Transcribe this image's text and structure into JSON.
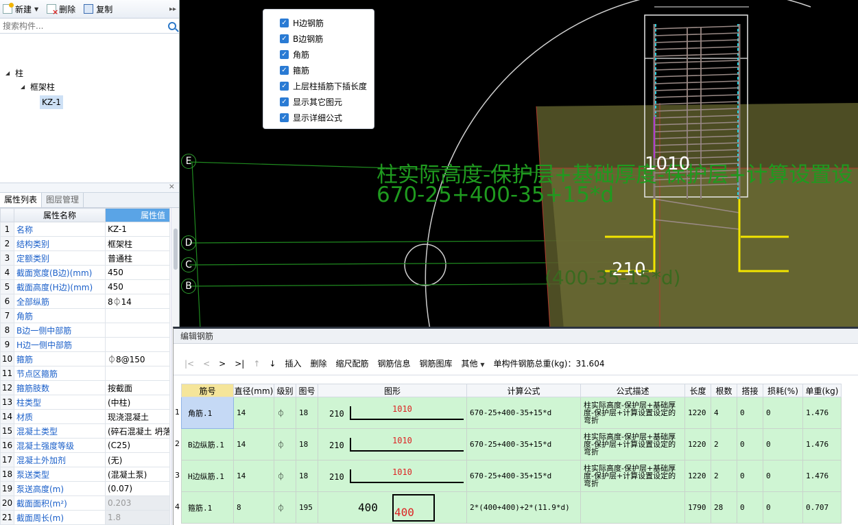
{
  "toolbar": {
    "new_label": "新建",
    "delete_label": "删除",
    "copy_label": "复制",
    "more": "▸▸"
  },
  "search": {
    "placeholder": "搜索构件..."
  },
  "tree": {
    "root": "柱",
    "child": "框架柱",
    "leaf": "KZ-1"
  },
  "tabs": {
    "props": "属性列表",
    "layers": "图层管理"
  },
  "props": {
    "col_name": "属性名称",
    "col_value": "属性值",
    "rows": [
      {
        "n": "1",
        "name": "名称",
        "value": "KZ-1"
      },
      {
        "n": "2",
        "name": "结构类别",
        "value": "框架柱"
      },
      {
        "n": "3",
        "name": "定额类别",
        "value": "普通柱"
      },
      {
        "n": "4",
        "name": "截面宽度(B边)(mm)",
        "value": "450"
      },
      {
        "n": "5",
        "name": "截面高度(H边)(mm)",
        "value": "450"
      },
      {
        "n": "6",
        "name": "全部纵筋",
        "value": "8⏀14"
      },
      {
        "n": "7",
        "name": "角筋",
        "value": ""
      },
      {
        "n": "8",
        "name": "B边一侧中部筋",
        "value": ""
      },
      {
        "n": "9",
        "name": "H边一侧中部筋",
        "value": ""
      },
      {
        "n": "10",
        "name": "箍筋",
        "value": "⏀8@150"
      },
      {
        "n": "11",
        "name": "节点区箍筋",
        "value": ""
      },
      {
        "n": "12",
        "name": "箍筋肢数",
        "value": "按截面"
      },
      {
        "n": "13",
        "name": "柱类型",
        "value": "(中柱)"
      },
      {
        "n": "14",
        "name": "材质",
        "value": "现浇混凝土"
      },
      {
        "n": "15",
        "name": "混凝土类型",
        "value": "(碎石混凝土 坍落"
      },
      {
        "n": "16",
        "name": "混凝土强度等级",
        "value": "(C25)"
      },
      {
        "n": "17",
        "name": "混凝土外加剂",
        "value": "(无)"
      },
      {
        "n": "18",
        "name": "泵送类型",
        "value": "(混凝土泵)"
      },
      {
        "n": "19",
        "name": "泵送高度(m)",
        "value": "(0.07)"
      },
      {
        "n": "20",
        "name": "截面面积(m²)",
        "value": "0.203"
      },
      {
        "n": "21",
        "name": "截面周长(m)",
        "value": "1.8"
      }
    ]
  },
  "checkboxes": [
    {
      "label": "H边钢筋",
      "checked": true
    },
    {
      "label": "B边钢筋",
      "checked": true
    },
    {
      "label": "角筋",
      "checked": true
    },
    {
      "label": "箍筋",
      "checked": true
    },
    {
      "label": "上层柱插筋下插长度",
      "checked": true
    },
    {
      "label": "显示其它图元",
      "checked": true
    },
    {
      "label": "显示详细公式",
      "checked": true
    }
  ],
  "canvas": {
    "formula_text": "柱实际高度-保护层+基础厚度-保护层+计算设置设",
    "formula_numbers": "670-25+400-35+15*d",
    "dim_1010": "1010",
    "dim_210": "210",
    "dim_formula2": "(400-35-15*d)",
    "axes": [
      "E",
      "D",
      "C",
      "B"
    ]
  },
  "rebar": {
    "title": "编辑钢筋",
    "tools": {
      "first": "|<",
      "prev": "<",
      "next": ">",
      "last": ">|",
      "up": "↑",
      "down": "↓",
      "insert": "插入",
      "delete": "删除",
      "scale": "缩尺配筋",
      "info": "钢筋信息",
      "library": "钢筋图库",
      "other": "其他",
      "total": "单构件钢筋总重(kg)：31.604"
    },
    "columns": [
      "筋号",
      "直径(mm)",
      "级别",
      "图号",
      "图形",
      "计算公式",
      "公式描述",
      "长度",
      "根数",
      "搭接",
      "损耗(%)",
      "单重(kg)"
    ],
    "rows": [
      {
        "n": "1",
        "name": "角筋.1",
        "dia": "14",
        "grade": "⏀",
        "fig": "18",
        "s_left": "210",
        "s_len": "1010",
        "formula": "670-25+400-35+15*d",
        "desc": "柱实际高度-保护层+基础厚度-保护层+计算设置设定的弯折",
        "length": "1220",
        "count": "4",
        "lap": "0",
        "loss": "0",
        "weight": "1.476"
      },
      {
        "n": "2",
        "name": "B边纵筋.1",
        "dia": "14",
        "grade": "⏀",
        "fig": "18",
        "s_left": "210",
        "s_len": "1010",
        "formula": "670-25+400-35+15*d",
        "desc": "柱实际高度-保护层+基础厚度-保护层+计算设置设定的弯折",
        "length": "1220",
        "count": "2",
        "lap": "0",
        "loss": "0",
        "weight": "1.476"
      },
      {
        "n": "3",
        "name": "H边纵筋.1",
        "dia": "14",
        "grade": "⏀",
        "fig": "18",
        "s_left": "210",
        "s_len": "1010",
        "formula": "670-25+400-35+15*d",
        "desc": "柱实际高度-保护层+基础厚度-保护层+计算设置设定的弯折",
        "length": "1220",
        "count": "2",
        "lap": "0",
        "loss": "0",
        "weight": "1.476"
      },
      {
        "n": "4",
        "name": "箍筋.1",
        "dia": "8",
        "grade": "⏀",
        "fig": "195",
        "s_left": "400",
        "s_len": "400",
        "formula": "2*(400+400)+2*(11.9*d)",
        "desc": "",
        "length": "1790",
        "count": "28",
        "lap": "0",
        "loss": "0",
        "weight": "0.707"
      }
    ]
  }
}
